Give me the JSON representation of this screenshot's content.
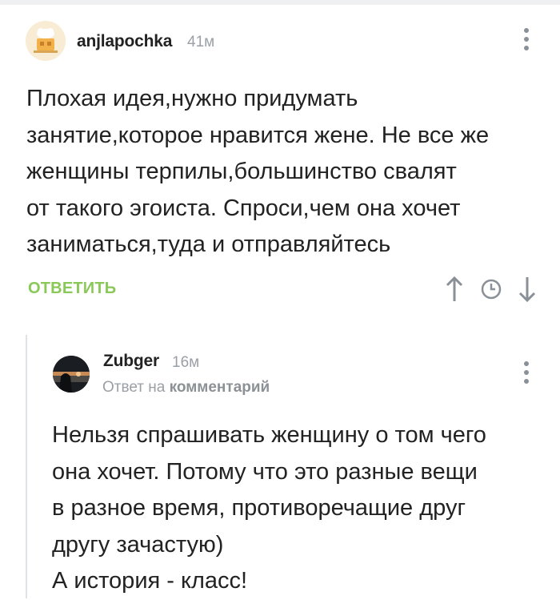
{
  "comment": {
    "username": "anjlapochka",
    "time": "41м",
    "text_lines": [
      "Плохая идея,нужно придумать",
      "занятие,которое нравится жене. Не все же",
      "женщины терпилы,большинство свалят",
      "от такого эгоиста. Спроси,чем она хочет",
      "заниматься,туда и отправляйтесь"
    ],
    "reply_label": "ОТВЕТИТЬ",
    "icons": [
      "arrow-up-icon",
      "clock-icon",
      "arrow-down-icon",
      "more-vertical-icon"
    ]
  },
  "reply": {
    "username": "Zubger",
    "time": "16м",
    "reply_prefix": "Ответ на",
    "reply_target": "комментарий",
    "text_lines": [
      "Нельзя спрашивать женщину о том чего",
      "она хочет. Потому что это разные вещи",
      "в разное время, противоречащие друг",
      "другу зачастую)",
      "А история - класс!"
    ]
  },
  "colors": {
    "accent_green": "#8ac858",
    "muted_gray": "#9aa0a6",
    "text": "#222222",
    "thread_line": "#dfe3e6"
  }
}
